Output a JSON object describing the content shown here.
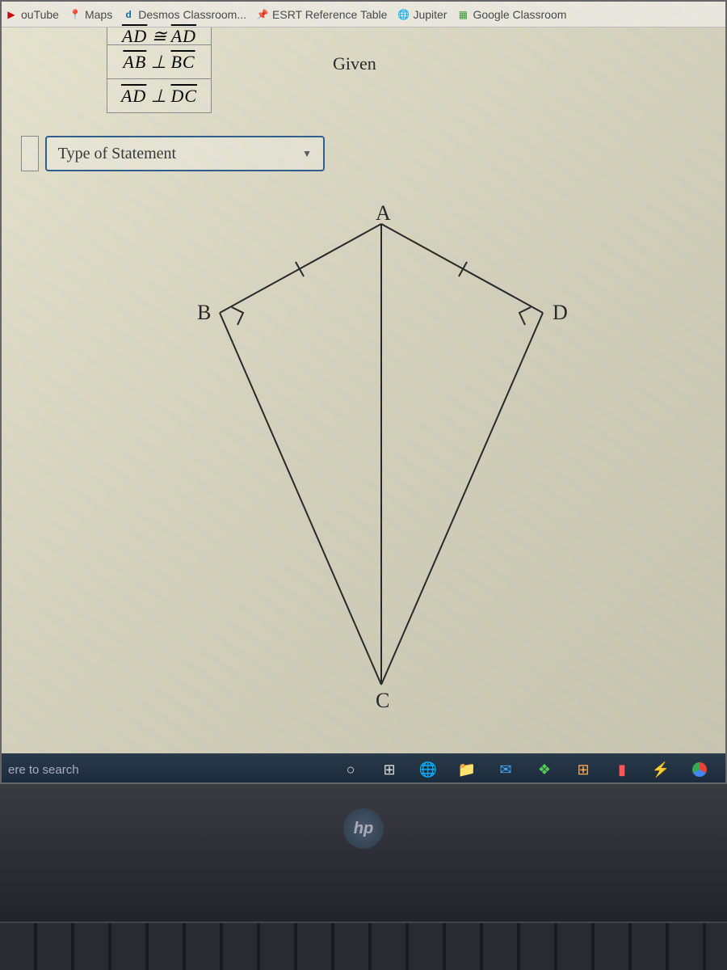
{
  "bookmarks": [
    {
      "label": "ouTube"
    },
    {
      "label": "Maps"
    },
    {
      "label": "Desmos Classroom..."
    },
    {
      "label": "ESRT Reference Table"
    },
    {
      "label": "Jupiter"
    },
    {
      "label": "Google Classroom"
    }
  ],
  "proof": {
    "rows": [
      {
        "statement_left": "AD",
        "relation": "≅",
        "statement_right": "AD",
        "reason": ""
      },
      {
        "statement_left": "AB",
        "relation": "⊥",
        "statement_right": "BC",
        "reason": "Given"
      },
      {
        "statement_left": "AD",
        "relation": "⊥",
        "statement_right": "DC",
        "reason": ""
      }
    ],
    "dropdown_label": "Type of Statement"
  },
  "diagram": {
    "vertices": {
      "A": "A",
      "B": "B",
      "C": "C",
      "D": "D"
    }
  },
  "taskbar": {
    "search_placeholder": "ere to search"
  },
  "bezel": {
    "logo": "hp"
  }
}
